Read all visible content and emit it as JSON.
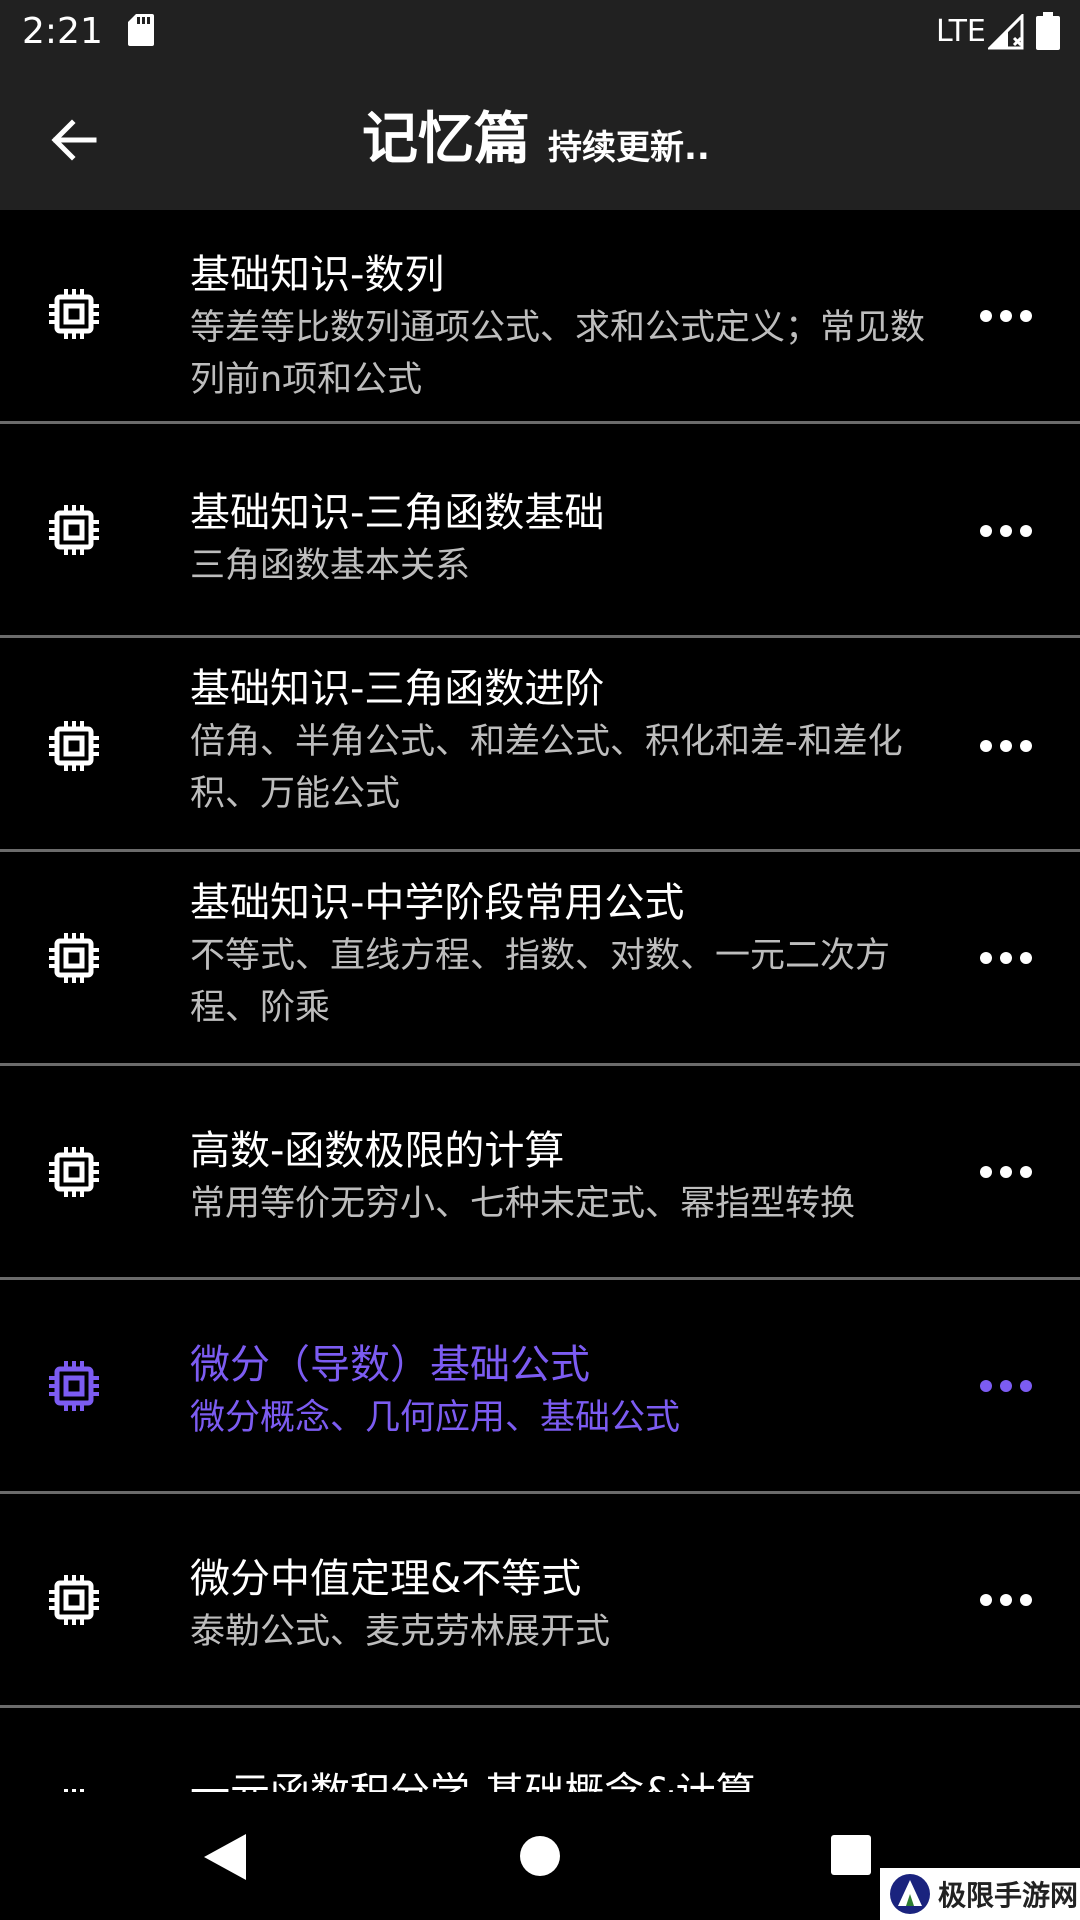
{
  "status_bar": {
    "time": "2:21",
    "network": "LTE",
    "icons": [
      "sd-card-icon",
      "signal-icon",
      "battery-icon"
    ]
  },
  "app_bar": {
    "title": "记忆篇",
    "subtitle": "持续更新.."
  },
  "colors": {
    "background": "#000000",
    "bar": "#212121",
    "accent": "#7c5cf2",
    "text_primary": "#ffffff",
    "text_secondary": "#bdbdbd",
    "divider": "#6b6b6b"
  },
  "list": {
    "items": [
      {
        "title": "基础知识-数列",
        "desc": "等差等比数列通项公式、求和公式定义；常见数列前n项和公式",
        "active": false
      },
      {
        "title": "基础知识-三角函数基础",
        "desc": "三角函数基本关系",
        "active": false
      },
      {
        "title": "基础知识-三角函数进阶",
        "desc": "倍角、半角公式、和差公式、积化和差-和差化积、万能公式",
        "active": false
      },
      {
        "title": "基础知识-中学阶段常用公式",
        "desc": "不等式、直线方程、指数、对数、一元二次方程、阶乘",
        "active": false
      },
      {
        "title": "高数-函数极限的计算",
        "desc": "常用等价无穷小、七种未定式、幂指型转换",
        "active": false
      },
      {
        "title": "微分（导数）基础公式",
        "desc": "微分概念、几何应用、基础公式",
        "active": true
      },
      {
        "title": "微分中值定理&不等式",
        "desc": "泰勒公式、麦克劳林展开式",
        "active": false
      },
      {
        "title": "一元函数积分学-基础概念&计算",
        "desc": "",
        "active": false
      }
    ]
  },
  "watermark": {
    "text": "极限手游网"
  }
}
